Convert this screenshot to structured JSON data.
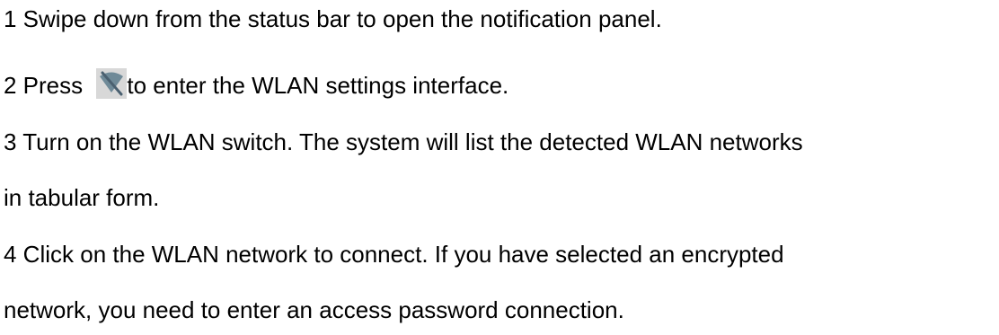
{
  "steps": {
    "step1": "1 Swipe down from the status bar to open the notification panel.",
    "step2_before": "2 Press ",
    "step2_after": "to enter the WLAN settings interface.",
    "step2_icon": "wlan-off-icon",
    "step3_line1": "3 Turn on the WLAN switch. The system will list the detected WLAN networks",
    "step3_line2": "in tabular form.",
    "step4_line1": "4 Click on the WLAN network to connect. If you have selected an encrypted",
    "step4_line2": "network, you need to enter an access password connection."
  }
}
